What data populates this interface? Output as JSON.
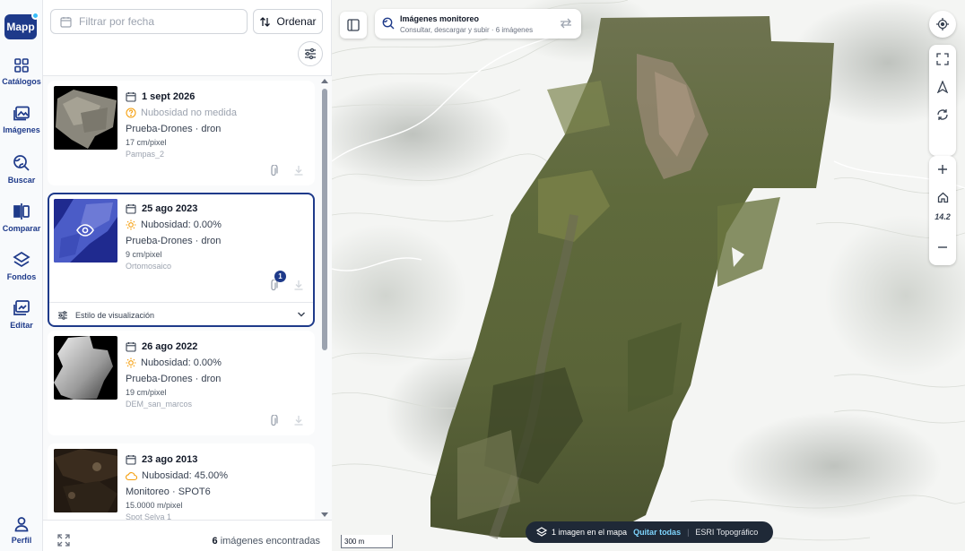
{
  "rail": {
    "logo": "Mapp",
    "items": [
      {
        "label": "Catálogos",
        "icon": "grid-icon"
      },
      {
        "label": "Imágenes",
        "icon": "images-icon"
      },
      {
        "label": "Buscar",
        "icon": "search-globe-icon"
      },
      {
        "label": "Comparar",
        "icon": "compare-icon"
      },
      {
        "label": "Fondos",
        "icon": "layers-icon"
      },
      {
        "label": "Editar",
        "icon": "edit-image-icon"
      }
    ],
    "profile": {
      "label": "Perfil",
      "icon": "person-icon"
    }
  },
  "panel": {
    "filter_placeholder": "Filtrar por fecha",
    "sort_label": "Ordenar",
    "cards": [
      {
        "date": "1 sept 2026",
        "cloud": "Nubosidad no medida",
        "cloud_icon": "help-circle-icon",
        "project": "Prueba-Drones · dron",
        "resolution": "17 cm/pixel",
        "name": "Pampas_2",
        "badge": ""
      },
      {
        "date": "25 ago 2023",
        "cloud": "Nubosidad: 0.00%",
        "cloud_icon": "sun-icon",
        "project": "Prueba-Drones · dron",
        "resolution": "9 cm/pixel",
        "name": "Ortomosaico",
        "badge": "1",
        "style_label": "Estilo de visualización"
      },
      {
        "date": "26 ago 2022",
        "cloud": "Nubosidad: 0.00%",
        "cloud_icon": "sun-icon",
        "project": "Prueba-Drones · dron",
        "resolution": "19 cm/pixel",
        "name": "DEM_san_marcos",
        "badge": ""
      },
      {
        "date": "23 ago 2013",
        "cloud": "Nubosidad: 45.00%",
        "cloud_icon": "cloud-icon",
        "project": "Monitoreo · SPOT6",
        "resolution": "15.0000 m/pixel",
        "name": "Spot Selva 1",
        "badge": ""
      }
    ],
    "footer": {
      "count": "6",
      "count_suffix": " imágenes encontradas"
    }
  },
  "map": {
    "layer_title": "Imágenes monitoreo",
    "layer_subtitle": "Consultar, descargar y subir · 6 imágenes",
    "zoom": "14.2",
    "pill": {
      "count_text": "1 imagen en el mapa",
      "clear": "Quitar todas",
      "sep": "|",
      "basemap": "ESRI Topográfico"
    },
    "scale": "300 m"
  },
  "colors": {
    "accent": "#1e3a8a",
    "sun": "#f59e0b",
    "link": "#7dd3fc"
  }
}
